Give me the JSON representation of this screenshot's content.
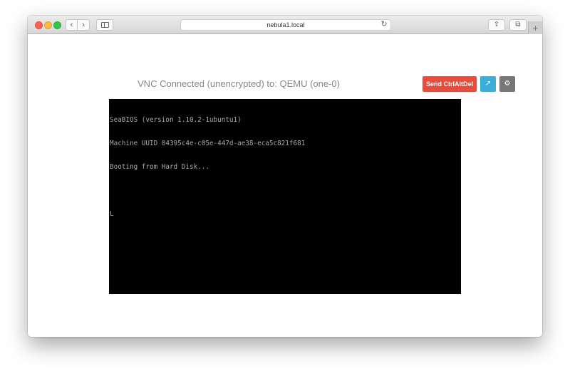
{
  "browser": {
    "url": "nebula1.local",
    "icons": {
      "back": "chevron-left-icon",
      "forward": "chevron-right-icon",
      "sidebar": "sidebar-icon",
      "reload": "reload-icon",
      "share": "share-icon",
      "tabs": "tabs-icon",
      "new_tab": "plus-icon"
    },
    "back_glyph": "‹",
    "forward_glyph": "›",
    "reload_glyph": "↻",
    "share_glyph": "⇪",
    "tabs_glyph": "⧉",
    "new_tab_glyph": "+"
  },
  "vnc": {
    "status": "VNC Connected (unencrypted) to: QEMU (one-0)",
    "send_ctrl_alt_del_label": "Send CtrlAltDel",
    "open_glyph": "↗",
    "settings_glyph": "⚙",
    "colors": {
      "ctrlaltdel": "#e74c3c",
      "open": "#3bafda",
      "settings": "#777777"
    }
  },
  "console": {
    "lines": [
      "SeaBIOS (version 1.10.2-1ubuntu1)",
      "Machine UUID 04395c4e-c05e-447d-ae38-eca5c821f681",
      "Booting from Hard Disk...",
      "",
      "L"
    ]
  }
}
